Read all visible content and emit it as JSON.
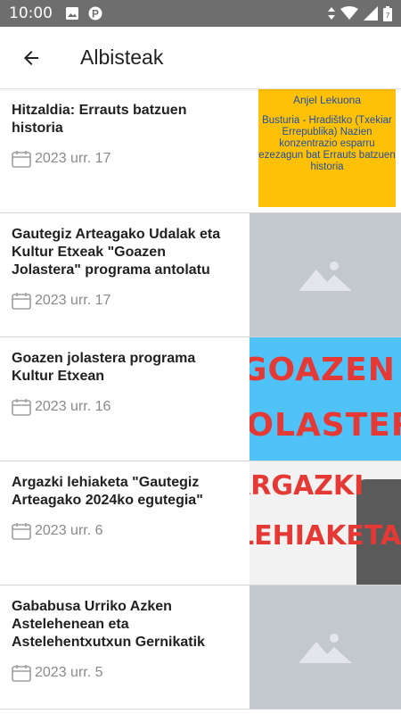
{
  "status_bar": {
    "time": "10:00",
    "icons": [
      "image-icon",
      "parking-p-icon",
      "wifi-signal-icon",
      "cell-signal-icon",
      "battery-icon"
    ]
  },
  "app_bar": {
    "title": "Albisteak",
    "back_icon": "arrow-left-icon"
  },
  "news": [
    {
      "title": "Hitzaldia: Errauts batzuen historia",
      "date": "2023 urr. 17",
      "thumb": "poster",
      "poster": {
        "name": "Anjel Lekuona",
        "text": "Busturia - Hradištko (Txekiar Errepublika) Nazien konzentrazio esparru ezezagun bat Errauts batzuen historia"
      }
    },
    {
      "title": "Gautegiz Arteagako Udalak eta Kultur Etxeak \"Goazen Jolastera\" programa antolatu",
      "date": "2023 urr. 17",
      "thumb": "placeholder"
    },
    {
      "title": "Goazen jolastera programa Kultur Etxean",
      "date": "2023 urr. 16",
      "thumb": "goazen",
      "image_text": [
        "GOAZEN",
        "JOLASTERA"
      ]
    },
    {
      "title": "Argazki lehiaketa \"Gautegiz Arteagako 2024ko egutegia\"",
      "date": "2023 urr. 6",
      "thumb": "argazki",
      "image_text": [
        "ARGAZKI",
        "LEHIAKETA"
      ]
    },
    {
      "title": "Gababusa Urriko Azken Astelehenean eta Astelehentxutxun Gernikatik",
      "date": "2023 urr. 5",
      "thumb": "placeholder"
    }
  ],
  "colors": {
    "status_bar": "#6e6e6e",
    "placeholder": "#c3c7ce",
    "poster_bg": "#ffc107",
    "poster_text": "#1f4fa3",
    "image_red": "#e53935",
    "image_blue": "#4fc3f7",
    "date_grey": "#8a8a8a"
  }
}
